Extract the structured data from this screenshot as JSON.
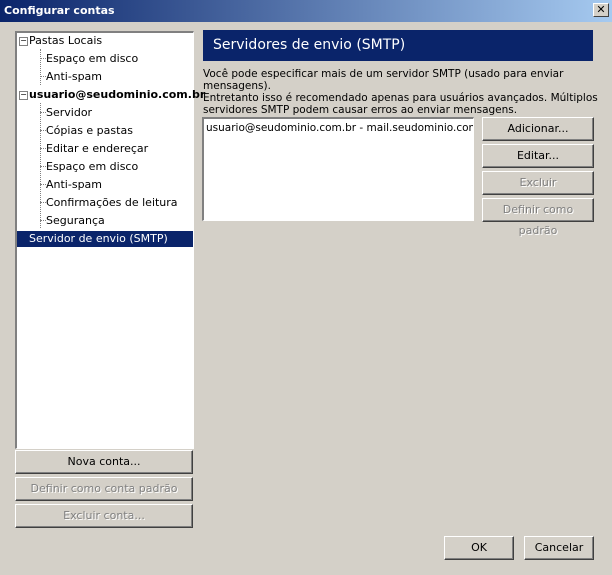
{
  "window": {
    "title": "Configurar contas",
    "close_symbol": "✕"
  },
  "tree": {
    "items": [
      {
        "label": "Pastas Locais",
        "level": 0,
        "toggle": "−"
      },
      {
        "label": "Espaço em disco",
        "level": 1
      },
      {
        "label": "Anti-spam",
        "level": 1
      },
      {
        "label": "usuario@seudominio.com.br",
        "level": 0,
        "toggle": "−",
        "bold": true
      },
      {
        "label": "Servidor",
        "level": 1
      },
      {
        "label": "Cópias e pastas",
        "level": 1
      },
      {
        "label": "Editar e endereçar",
        "level": 1
      },
      {
        "label": "Espaço em disco",
        "level": 1
      },
      {
        "label": "Anti-spam",
        "level": 1
      },
      {
        "label": "Confirmações de leitura",
        "level": 1
      },
      {
        "label": "Segurança",
        "level": 1
      },
      {
        "label": "Servidor de envio (SMTP)",
        "level": 0,
        "selected": true
      }
    ]
  },
  "left_buttons": {
    "new_account": "Nova conta...",
    "set_default": "Definir como conta padrão",
    "delete_account": "Excluir conta..."
  },
  "panel": {
    "heading": "Servidores de envio (SMTP)",
    "description_line1": "Você pode especificar mais de um servidor SMTP (usado para enviar mensagens).",
    "description_line2": "Entretanto isso é recomendado apenas para usuários avançados. Múltiplos",
    "description_line3": "servidores SMTP podem causar erros ao enviar mensagens.",
    "servers": [
      "usuario@seudominio.com.br - mail.seudominio.com.br (Padrão)"
    ],
    "buttons": {
      "add": "Adicionar...",
      "edit": "Editar...",
      "delete": "Excluir",
      "set_default": "Definir como padrão"
    }
  },
  "footer": {
    "ok": "OK",
    "cancel": "Cancelar"
  }
}
